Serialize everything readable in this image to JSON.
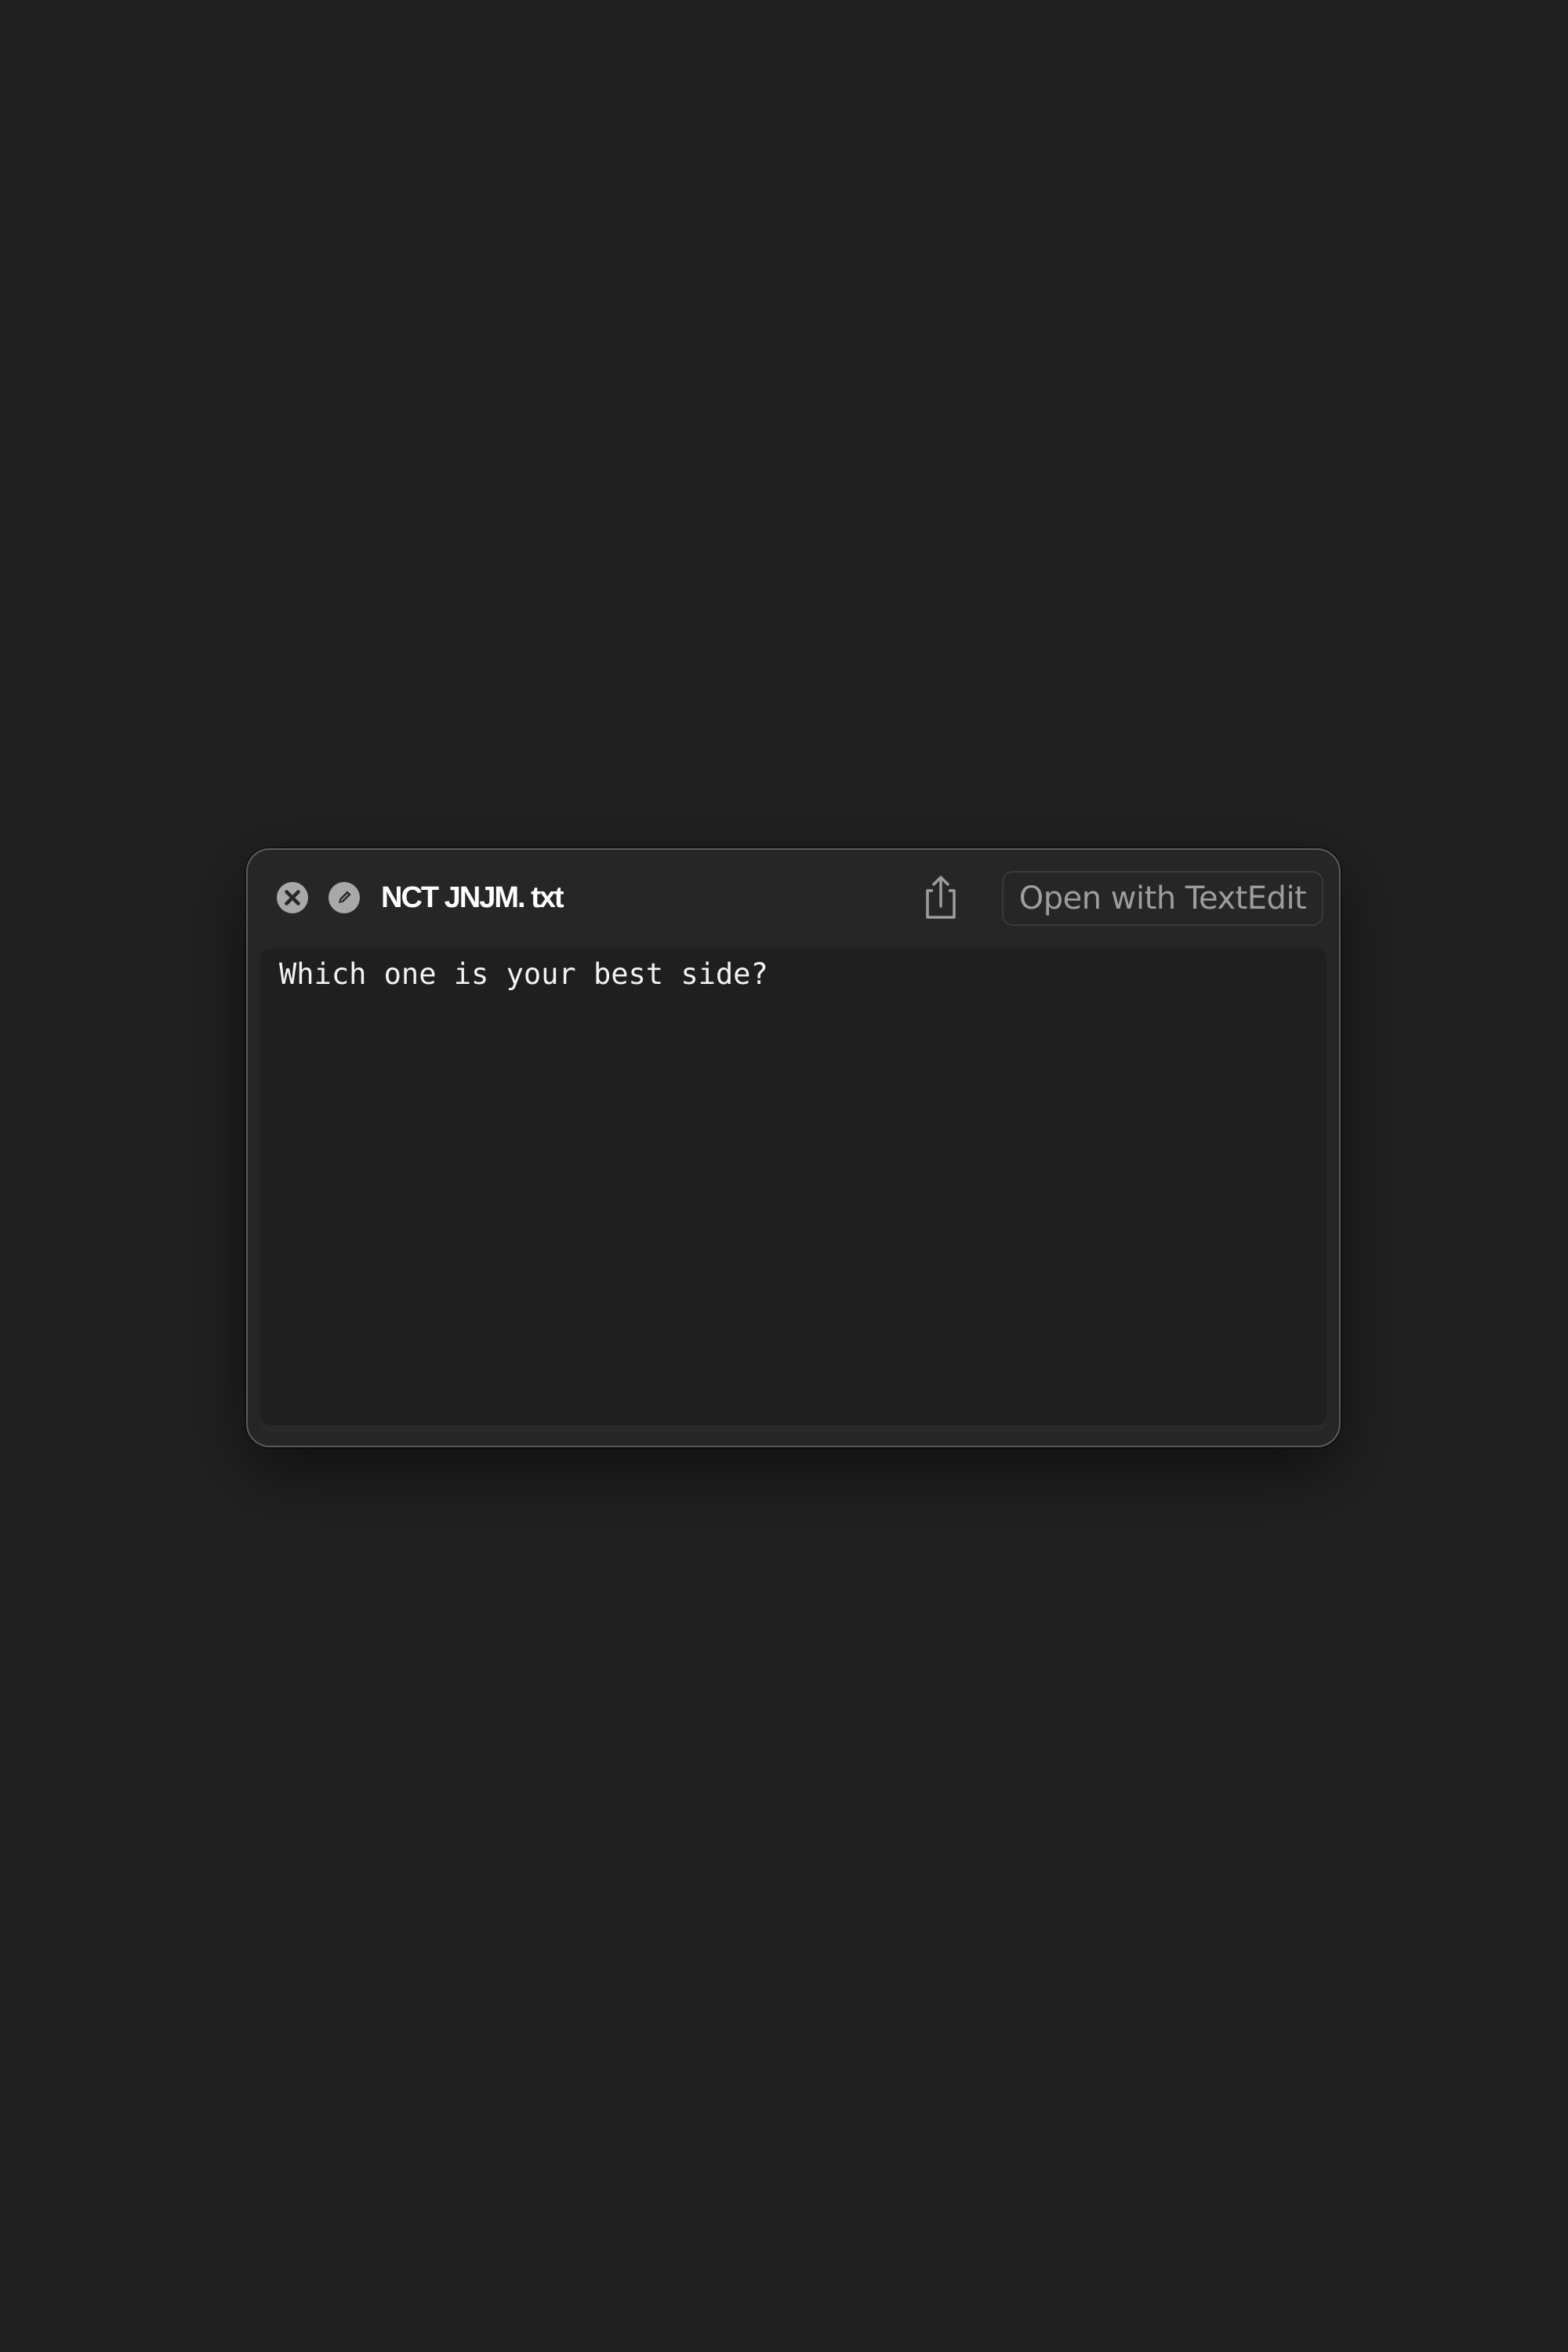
{
  "window": {
    "title": "NCT JNJM. txt",
    "open_button_label": "Open with TextEdit"
  },
  "icons": {
    "close": "close-circle-icon",
    "markup": "markup-pencil-icon",
    "share": "share-icon"
  },
  "document": {
    "text": "Which one is your best side?"
  },
  "colors": {
    "background": "#212121",
    "window": "#262626",
    "content": "#1f1f1f",
    "text": "#f2f2f2",
    "button_text": "#9d9d9d"
  }
}
